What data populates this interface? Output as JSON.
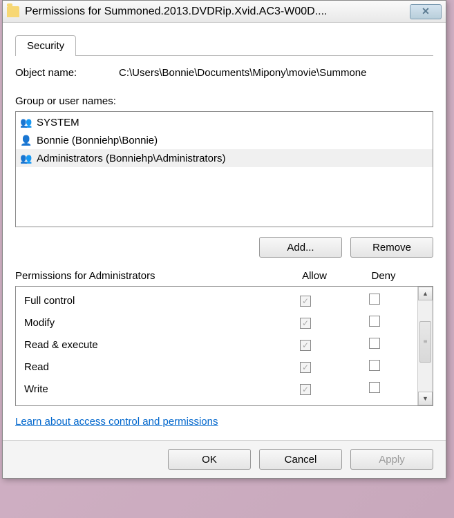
{
  "titlebar": {
    "title": "Permissions for Summoned.2013.DVDRip.Xvid.AC3-W00D...."
  },
  "tabs": {
    "security": "Security"
  },
  "object": {
    "label": "Object name:",
    "path": "C:\\Users\\Bonnie\\Documents\\Mipony\\movie\\Summone"
  },
  "groups": {
    "label": "Group or user names:",
    "items": [
      {
        "type": "group",
        "name": "SYSTEM",
        "selected": false
      },
      {
        "type": "user",
        "name": "Bonnie (Bonniehp\\Bonnie)",
        "selected": false
      },
      {
        "type": "group",
        "name": "Administrators (Bonniehp\\Administrators)",
        "selected": true
      }
    ]
  },
  "buttons": {
    "add": "Add...",
    "remove": "Remove",
    "ok": "OK",
    "cancel": "Cancel",
    "apply": "Apply"
  },
  "permissions": {
    "header_label": "Permissions for Administrators",
    "col_allow": "Allow",
    "col_deny": "Deny",
    "rows": [
      {
        "name": "Full control",
        "allow": true,
        "deny": false
      },
      {
        "name": "Modify",
        "allow": true,
        "deny": false
      },
      {
        "name": "Read & execute",
        "allow": true,
        "deny": false
      },
      {
        "name": "Read",
        "allow": true,
        "deny": false
      },
      {
        "name": "Write",
        "allow": true,
        "deny": false
      }
    ]
  },
  "link": {
    "text": "Learn about access control and permissions"
  }
}
